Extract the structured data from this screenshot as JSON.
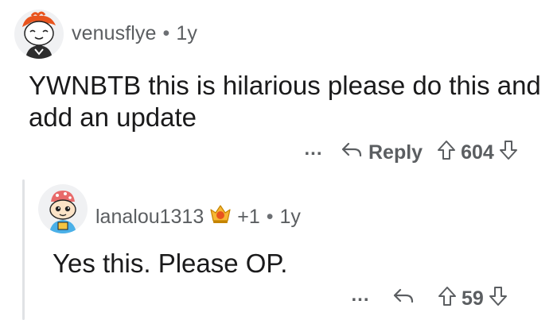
{
  "comment1": {
    "username": "venusflye",
    "age": "1y",
    "body": "YWNBTB this is hilarious please do this and add an update",
    "actions": {
      "more": "...",
      "reply": "Reply",
      "score": "604"
    }
  },
  "comment2": {
    "username": "lanalou1313",
    "award_count": "+1",
    "age": "1y",
    "body": "Yes this. Please OP.",
    "actions": {
      "more": "...",
      "score": "59"
    }
  },
  "colors": {
    "text": "#1a1a1b",
    "meta": "#5b5e61",
    "thread": "#e0e2e5"
  }
}
